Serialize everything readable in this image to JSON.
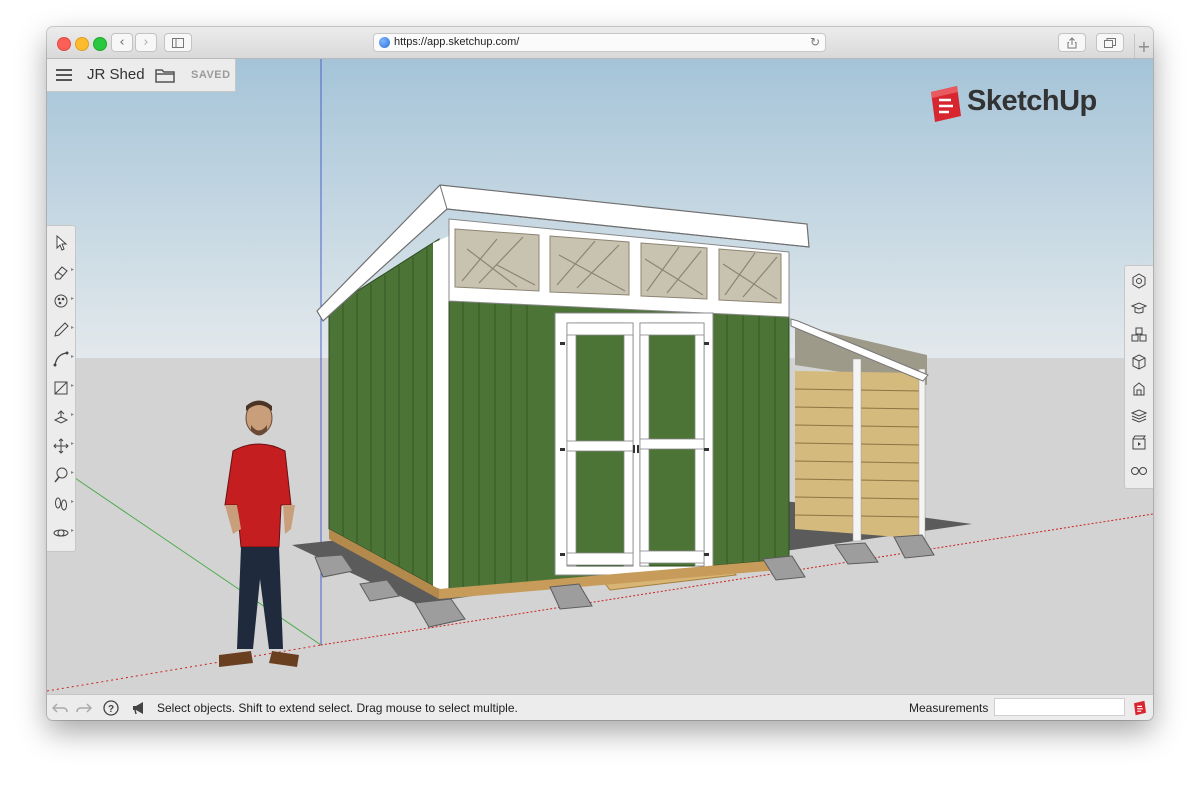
{
  "browser": {
    "url": "https://app.sketchup.com/",
    "back_icon": "chevron-left-icon",
    "forward_icon": "chevron-right-icon",
    "sidebar_icon": "sidebar-icon",
    "reload_icon": "reload-icon",
    "share_icon": "share-icon",
    "tabs_icon": "tabs-icon",
    "new_tab_label": "+"
  },
  "app": {
    "title": "JR Shed",
    "save_status": "SAVED",
    "logo_text": "SketchUp",
    "brand_color": "#d7262f"
  },
  "left_toolbar": {
    "tools": [
      {
        "name": "select-tool",
        "icon": "arrow-icon"
      },
      {
        "name": "eraser-tool",
        "icon": "eraser-icon"
      },
      {
        "name": "paint-bucket-tool",
        "icon": "paint-icon"
      },
      {
        "name": "line-tool",
        "icon": "pencil-icon"
      },
      {
        "name": "arc-tool",
        "icon": "arc-icon"
      },
      {
        "name": "rectangle-tool",
        "icon": "rectangle-icon"
      },
      {
        "name": "push-pull-tool",
        "icon": "push-pull-icon"
      },
      {
        "name": "move-tool",
        "icon": "move-icon"
      },
      {
        "name": "tape-measure-tool",
        "icon": "tape-icon"
      },
      {
        "name": "walk-tool",
        "icon": "footprints-icon"
      },
      {
        "name": "orbit-tool",
        "icon": "orbit-icon"
      }
    ]
  },
  "right_toolbar": {
    "panels": [
      {
        "name": "entity-info-panel",
        "icon": "entity-info-icon"
      },
      {
        "name": "instructor-panel",
        "icon": "mortarboard-icon"
      },
      {
        "name": "components-panel",
        "icon": "components-icon"
      },
      {
        "name": "materials-panel",
        "icon": "materials-icon"
      },
      {
        "name": "styles-panel",
        "icon": "styles-icon"
      },
      {
        "name": "layers-panel",
        "icon": "layers-icon"
      },
      {
        "name": "scenes-panel",
        "icon": "scenes-icon"
      },
      {
        "name": "display-panel",
        "icon": "glasses-icon"
      }
    ]
  },
  "status_bar": {
    "hint": "Select objects. Shift to extend select. Drag mouse to select multiple.",
    "measurements_label": "Measurements",
    "measurements_value": ""
  },
  "scene": {
    "sky_top": "#a9c7d9",
    "sky_bottom": "#dde6ea",
    "ground": "#d3d3d3",
    "wall_green": "#4e7a3a",
    "trim": "#ffffff",
    "ramp": "#d9b777",
    "shirt": "#c41e20"
  }
}
